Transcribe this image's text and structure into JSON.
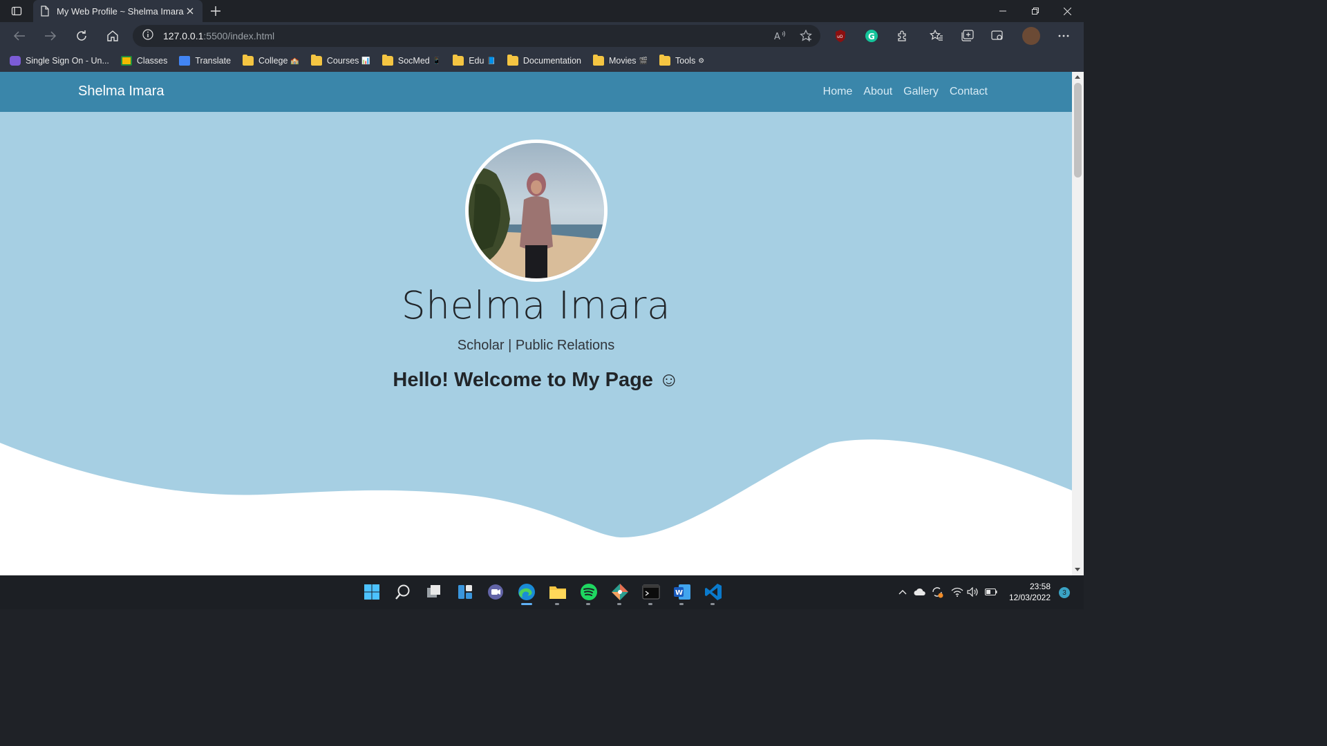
{
  "browser": {
    "tab": {
      "title": "My Web Profile ~ Shelma Imara"
    },
    "address": {
      "host": "127.0.0.1",
      "path": ":5500/index.html"
    },
    "bookmarks": [
      {
        "label": "Single Sign On - Un...",
        "icon": "sso-icon"
      },
      {
        "label": "Classes",
        "icon": "classroom-icon"
      },
      {
        "label": "Translate",
        "icon": "translate-icon"
      },
      {
        "label": "College",
        "emoji": "🏫",
        "icon": "folder-icon"
      },
      {
        "label": "Courses",
        "emoji": "📊",
        "icon": "folder-icon"
      },
      {
        "label": "SocMed",
        "emoji": "📱",
        "icon": "folder-icon"
      },
      {
        "label": "Edu",
        "emoji": "📘",
        "icon": "folder-icon"
      },
      {
        "label": "Documentation",
        "icon": "folder-icon"
      },
      {
        "label": "Movies",
        "emoji": "🎬",
        "icon": "folder-icon"
      },
      {
        "label": "Tools",
        "emoji": "⚙",
        "icon": "folder-icon"
      }
    ]
  },
  "site": {
    "brand": "Shelma Imara",
    "nav": [
      "Home",
      "About",
      "Gallery",
      "Contact"
    ],
    "hero": {
      "name": "Shelma Imara",
      "subtitle": "Scholar | Public Relations",
      "welcome": "Hello! Welcome to My Page ☺"
    },
    "colors": {
      "navbar": "#3a86aa",
      "hero_bg": "#a6cfe3"
    }
  },
  "taskbar": {
    "time": "23:58",
    "date": "12/03/2022",
    "notifications": "3"
  }
}
